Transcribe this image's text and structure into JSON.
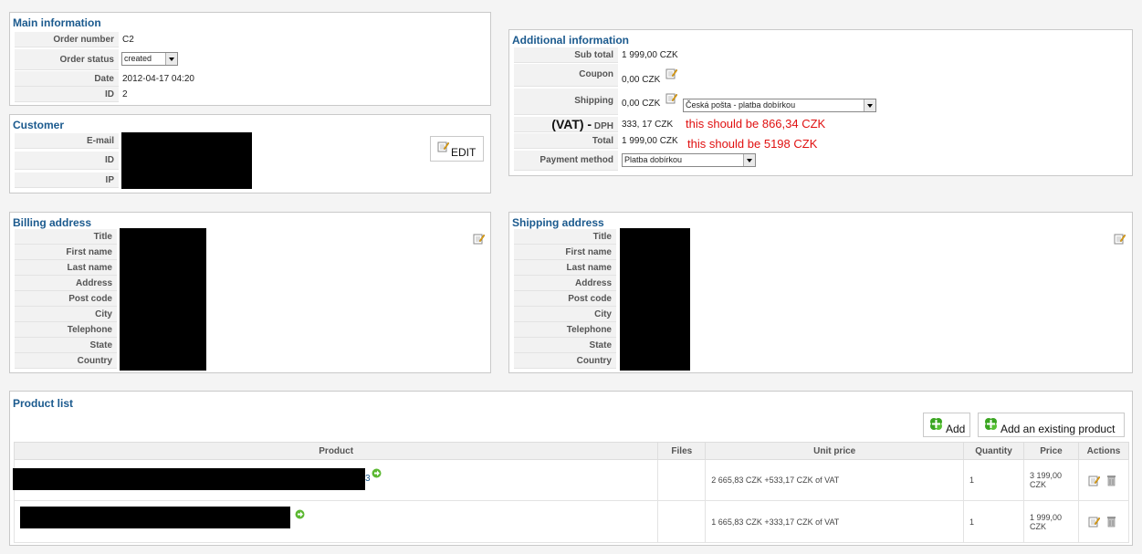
{
  "main_info": {
    "title": "Main information",
    "order_number_label": "Order number",
    "order_number": "C2",
    "order_status_label": "Order status",
    "order_status": "created",
    "date_label": "Date",
    "date": "2012-04-17 04:20",
    "id_label": "ID",
    "id": "2"
  },
  "customer": {
    "title": "Customer",
    "email_label": "E-mail",
    "id_label": "ID",
    "ip_label": "IP",
    "edit_label": "EDIT"
  },
  "additional_info": {
    "title": "Additional information",
    "subtotal_label": "Sub total",
    "subtotal": "1 999,00 CZK",
    "coupon_label": "Coupon",
    "coupon": "0,00 CZK",
    "shipping_label": "Shipping",
    "shipping": "0,00 CZK",
    "shipping_method": "Česká  pošta  - platba  dobírkou",
    "vat_prefix": "(VAT) -",
    "dph_label": "DPH",
    "dph": "333, 17 CZK",
    "dph_note": "this should be 866,34 CZK",
    "total_label": "Total",
    "total": "1 999,00 CZK",
    "total_note": "this should be 5198 CZK",
    "payment_label": "Payment method",
    "payment_method": "Platba  dobírkou"
  },
  "billing": {
    "title": "Billing address",
    "labels": [
      "Title",
      "First name",
      "Last name",
      "Address",
      "Post code",
      "City",
      "Telephone",
      "State",
      "Country"
    ]
  },
  "shipping_addr": {
    "title": "Shipping address",
    "labels": [
      "Title",
      "First name",
      "Last name",
      "Address",
      "Post code",
      "City",
      "Telephone",
      "State",
      "Country"
    ]
  },
  "products": {
    "title": "Product list",
    "add_label": "Add",
    "add_existing_label": "Add an existing product",
    "columns": [
      "Product",
      "Files",
      "Unit price",
      "Quantity",
      "Price",
      "Actions"
    ],
    "rows": [
      {
        "product_tail": "3",
        "unit_price": "2 665,83  CZK +533,17  CZK of  VAT",
        "quantity": "1",
        "price_line1": "3 199,00",
        "price_line2": "CZK"
      },
      {
        "product_tail": "",
        "unit_price": "1 665,83  CZK +333,17  CZK of  VAT",
        "quantity": "1",
        "price_line1": "1 999,00",
        "price_line2": "CZK"
      }
    ]
  },
  "colors": {
    "title_blue": "#1b5a8e",
    "note_red": "#e01010",
    "add_green": "#3aa521"
  }
}
